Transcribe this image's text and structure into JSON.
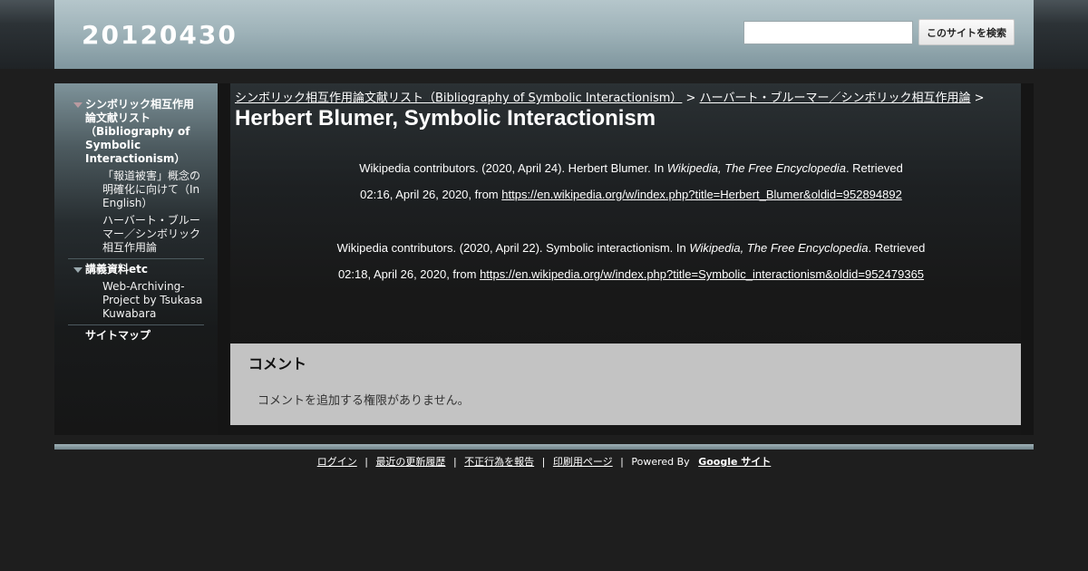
{
  "header": {
    "site_title": "20120430",
    "search_placeholder": "",
    "search_button": "このサイトを検索"
  },
  "sidebar": {
    "items": [
      {
        "label": "シンボリック相互作用論文献リスト（Bibliography of Symbolic Interactionism）",
        "children": [
          "「報道被害」概念の明確化に向けて（In English）",
          "ハーバート・ブルーマー／シンボリック相互作用論"
        ]
      },
      {
        "label": "講義資料etc",
        "children": [
          "Web-Archiving-Project by Tsukasa Kuwabara"
        ]
      },
      {
        "label": "サイトマップ",
        "children": []
      }
    ]
  },
  "main": {
    "breadcrumb": [
      "シンボリック相互作用論文献リスト（Bibliography of Symbolic Interactionism）",
      "ハーバート・ブルーマー／シンボリック相互作用論"
    ],
    "breadcrumb_sep": ">",
    "title": "Herbert Blumer, Symbolic Interactionism",
    "citations": [
      {
        "pre": "Wikipedia contributors. (2020, April 24). Herbert Blumer. In ",
        "italic": "Wikipedia, The Free Encyclopedia",
        "post": ". Retrieved",
        "line2": "02:16, April 26, 2020, from ",
        "url": "https://en.wikipedia.org/w/index.php?title=Herbert_Blumer&oldid=952894892"
      },
      {
        "pre": "Wikipedia contributors. (2020, April 22). Symbolic interactionism. In ",
        "italic": "Wikipedia, The Free Encyclopedia",
        "post": ". Retrieved",
        "line2": "02:18, April 26, 2020, from ",
        "url": "https://en.wikipedia.org/w/index.php?title=Symbolic_interactionism&oldid=952479365"
      }
    ]
  },
  "comments": {
    "title": "コメント",
    "message": "コメントを追加する権限がありません。"
  },
  "footer": {
    "links": [
      "ログイン",
      "最近の更新履歴",
      "不正行為を報告",
      "印刷用ページ"
    ],
    "sep": "|",
    "powered": "Powered By",
    "google": "Google サイト"
  }
}
